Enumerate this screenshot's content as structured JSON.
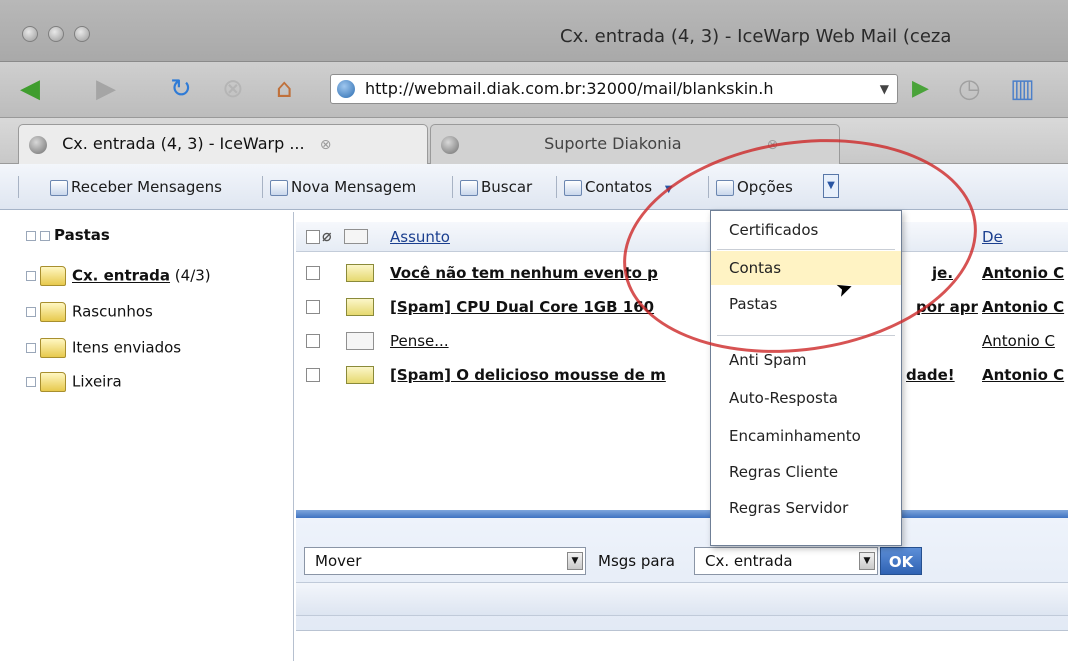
{
  "window": {
    "title": "Cx. entrada (4, 3) - IceWarp Web Mail (ceza"
  },
  "browser": {
    "url": "http://webmail.diak.com.br:32000/mail/blankskin.h",
    "tabs": [
      {
        "label": "Cx. entrada (4, 3) - IceWarp ..."
      },
      {
        "label": "Suporte Diakonia"
      }
    ]
  },
  "toolbar": {
    "receive_label": "Receber Mensagens",
    "new_label": "Nova Mensagem",
    "search_label": "Buscar",
    "contacts_label": "Contatos",
    "options_label": "Opções"
  },
  "folders": {
    "root_label": "Pastas",
    "items": [
      {
        "label": "Cx. entrada",
        "count": "(4/3)"
      },
      {
        "label": "Rascunhos"
      },
      {
        "label": "Itens enviados"
      },
      {
        "label": "Lixeira"
      }
    ]
  },
  "message_list": {
    "columns": {
      "subject": "Assunto",
      "from": "De"
    },
    "rows": [
      {
        "subject": "Você não tem nenhum evento p",
        "from": "Antonio C",
        "unread": true
      },
      {
        "subject": "[Spam] CPU Dual Core 1GB 160",
        "from": "Antonio C",
        "unread": true
      },
      {
        "subject": "Pense...",
        "from": "Antonio C",
        "unread": false
      },
      {
        "subject": "[Spam] O delicioso mousse de m",
        "from": "Antonio C",
        "unread": true
      }
    ],
    "partial_text": {
      "row1": "je.",
      "row2": "por apr",
      "row4": "dade!"
    }
  },
  "actions": {
    "move_label": "Mover",
    "msgs_for_label": "Msgs para",
    "target_folder": "Cx. entrada",
    "ok_label": "OK"
  },
  "options_menu": {
    "items": [
      "Certificados",
      "Contas",
      "Pastas",
      "Anti Spam",
      "Auto-Resposta",
      "Encaminhamento",
      "Regras Cliente",
      "Regras Servidor"
    ],
    "highlighted": "Contas"
  },
  "colors": {
    "toolbar_bg": "#dfe6f1",
    "accent": "#2f62b3",
    "annotation": "#cd2828",
    "menu_highlight": "#fff3c4"
  }
}
